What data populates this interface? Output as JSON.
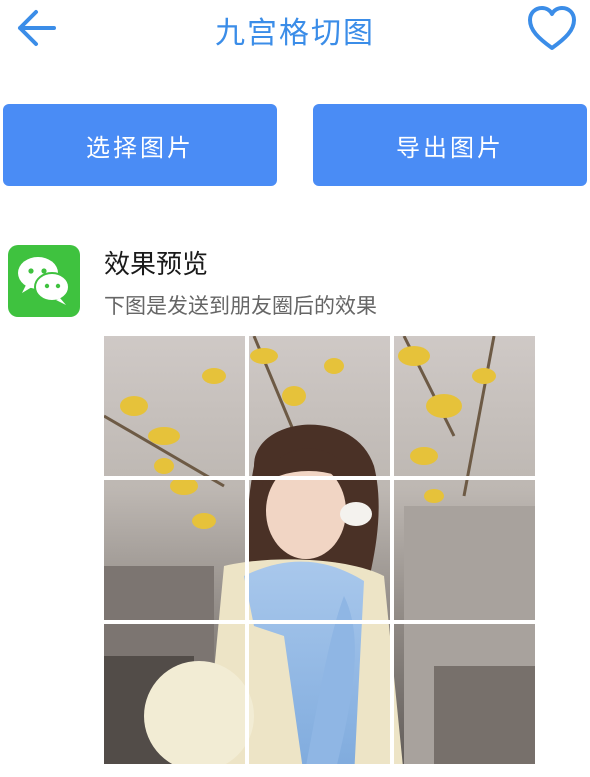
{
  "header": {
    "title": "九宫格切图",
    "back_icon": "arrow-left-icon",
    "favorite_icon": "heart-outline-icon"
  },
  "actions": {
    "select_label": "选择图片",
    "export_label": "导出图片"
  },
  "preview": {
    "app_icon": "wechat-icon",
    "title": "效果预览",
    "subtitle": "下图是发送到朋友圈后的效果"
  },
  "colors": {
    "accent": "#4a8cf5",
    "title": "#3b8de8",
    "wechat_green": "#3fc23f"
  }
}
